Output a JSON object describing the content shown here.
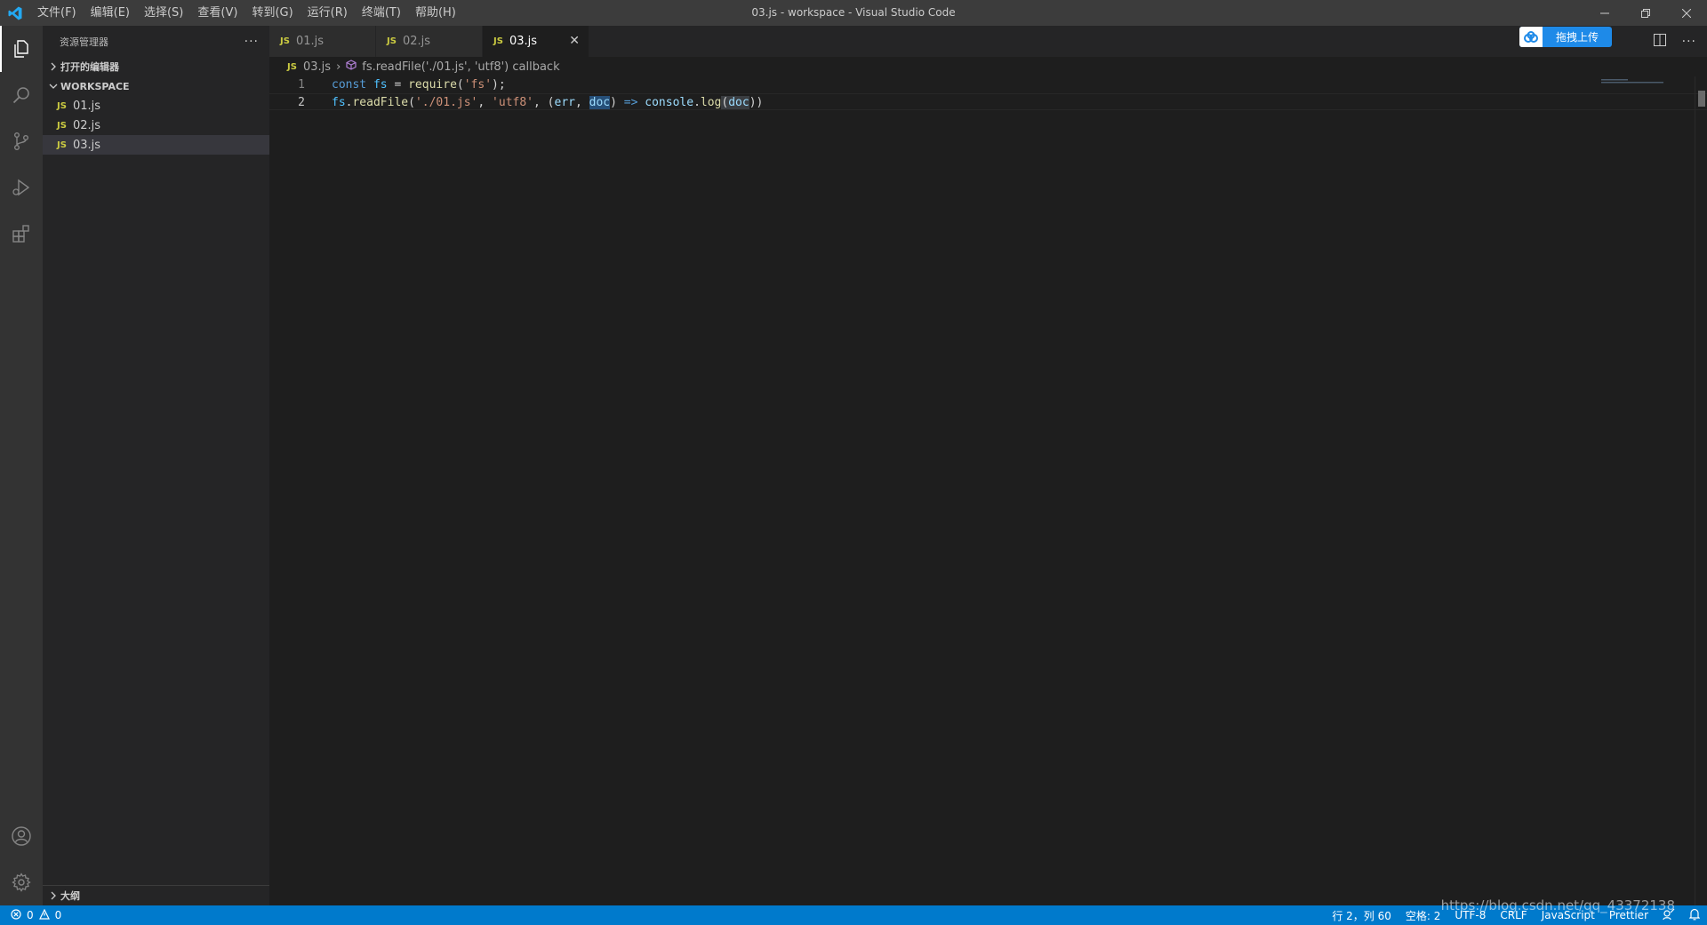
{
  "titlebar": {
    "menus": [
      "文件(F)",
      "编辑(E)",
      "选择(S)",
      "查看(V)",
      "转到(G)",
      "运行(R)",
      "终端(T)",
      "帮助(H)"
    ],
    "window_title": "03.js - workspace - Visual Studio Code"
  },
  "sidebar": {
    "title": "资源管理器",
    "open_editors": "打开的编辑器",
    "workspace": "WORKSPACE",
    "files": [
      "01.js",
      "02.js",
      "03.js"
    ],
    "outline": "大纲",
    "js_badge": "JS"
  },
  "tabs": [
    {
      "label": "01.js",
      "active": false
    },
    {
      "label": "02.js",
      "active": false
    },
    {
      "label": "03.js",
      "active": true
    }
  ],
  "upload_button": "拖拽上传",
  "breadcrumb": {
    "file": "03.js",
    "symbol": "fs.readFile('./01.js', 'utf8') callback"
  },
  "editor": {
    "line_numbers": [
      "1",
      "2"
    ],
    "line1": {
      "kw": "const",
      "var": "fs",
      "eq": " = ",
      "fn": "require",
      "open": "(",
      "str": "'fs'",
      "close": ");"
    },
    "line2": {
      "obj": "fs",
      "dot": ".",
      "fn": "readFile",
      "p1": "(",
      "s1": "'./01.js'",
      "c1": ", ",
      "s2": "'utf8'",
      "c2": ", (",
      "a1": "err",
      "c3": ", ",
      "a2": "doc",
      "arrow1": ") ",
      "arrow": "=>",
      "sp": " ",
      "obj2": "console",
      "dot2": ".",
      "fn2": "log",
      "p2": "(",
      "a3": "doc",
      "p3": "))"
    }
  },
  "statusbar": {
    "errors": "0",
    "warnings": "0",
    "position": "行 2，列 60",
    "spaces": "空格: 2",
    "encoding": "UTF-8",
    "eol": "CRLF",
    "language": "JavaScript",
    "formatter": "Prettier"
  },
  "watermark": "https://blog.csdn.net/qq_43372138",
  "colors": {
    "accent": "#007acc",
    "js_badge": "#cbcb41"
  }
}
